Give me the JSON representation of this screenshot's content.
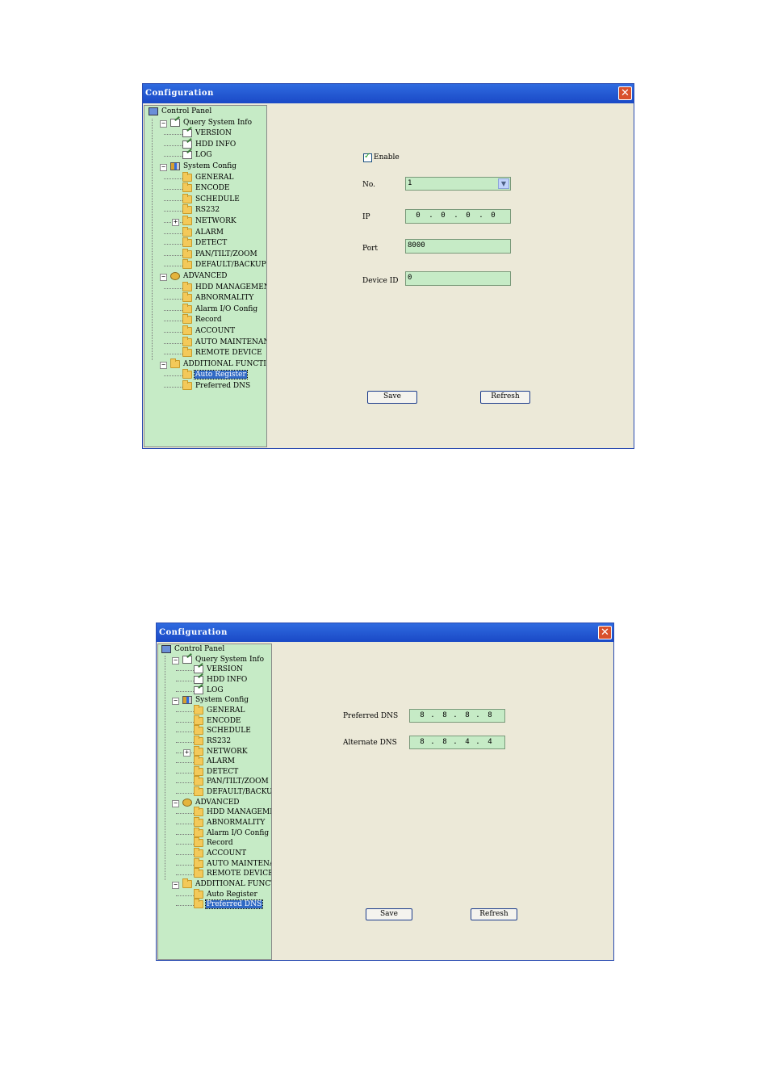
{
  "window1": {
    "title": "Configuration",
    "close_glyph": "✕",
    "tree": [
      {
        "label": "Control Panel",
        "icon": "computer-icon"
      },
      {
        "label": "Query System Info",
        "icon": "query-icon"
      },
      {
        "label": "VERSION",
        "icon": "doc-icon"
      },
      {
        "label": "HDD INFO",
        "icon": "doc-icon"
      },
      {
        "label": "LOG",
        "icon": "doc-icon"
      },
      {
        "label": "System Config",
        "icon": "config-icon"
      },
      {
        "label": "GENERAL",
        "icon": "folder-icon"
      },
      {
        "label": "ENCODE",
        "icon": "folder-icon"
      },
      {
        "label": "SCHEDULE",
        "icon": "folder-icon"
      },
      {
        "label": "RS232",
        "icon": "folder-icon"
      },
      {
        "label": "NETWORK",
        "icon": "folder-icon"
      },
      {
        "label": "ALARM",
        "icon": "folder-icon"
      },
      {
        "label": "DETECT",
        "icon": "folder-icon"
      },
      {
        "label": "PAN/TILT/ZOOM",
        "icon": "folder-icon"
      },
      {
        "label": "DEFAULT/BACKUP",
        "icon": "folder-icon"
      },
      {
        "label": "ADVANCED",
        "icon": "advanced-icon"
      },
      {
        "label": "HDD MANAGEMENT",
        "icon": "folder-icon"
      },
      {
        "label": "ABNORMALITY",
        "icon": "folder-icon"
      },
      {
        "label": "Alarm I/O Config",
        "icon": "folder-icon"
      },
      {
        "label": "Record",
        "icon": "folder-icon"
      },
      {
        "label": "ACCOUNT",
        "icon": "folder-icon"
      },
      {
        "label": "AUTO MAINTENANCE",
        "icon": "folder-icon"
      },
      {
        "label": "REMOTE DEVICE",
        "icon": "folder-icon"
      },
      {
        "label": "ADDITIONAL FUNCTION",
        "icon": "folder-icon"
      },
      {
        "label": "Auto Register",
        "icon": "folder-icon"
      },
      {
        "label": "Preferred DNS",
        "icon": "folder-icon"
      }
    ],
    "selected": "Auto Register",
    "form": {
      "enable_label": "Enable",
      "enable_checked": true,
      "no_label": "No.",
      "no_value": "1",
      "ip_label": "IP",
      "ip": [
        "0",
        "0",
        "0",
        "0"
      ],
      "port_label": "Port",
      "port_value": "8000",
      "device_id_label": "Device ID",
      "device_id_value": "0",
      "save_label": "Save",
      "refresh_label": "Refresh"
    }
  },
  "window2": {
    "title": "Configuration",
    "close_glyph": "✕",
    "selected": "Preferred DNS",
    "form": {
      "preferred_dns_label": "Preferred DNS",
      "preferred_dns": [
        "8",
        "8",
        "8",
        "8"
      ],
      "alternate_dns_label": "Alternate DNS",
      "alternate_dns": [
        "8",
        "8",
        "4",
        "4"
      ],
      "save_label": "Save",
      "refresh_label": "Refresh"
    }
  }
}
